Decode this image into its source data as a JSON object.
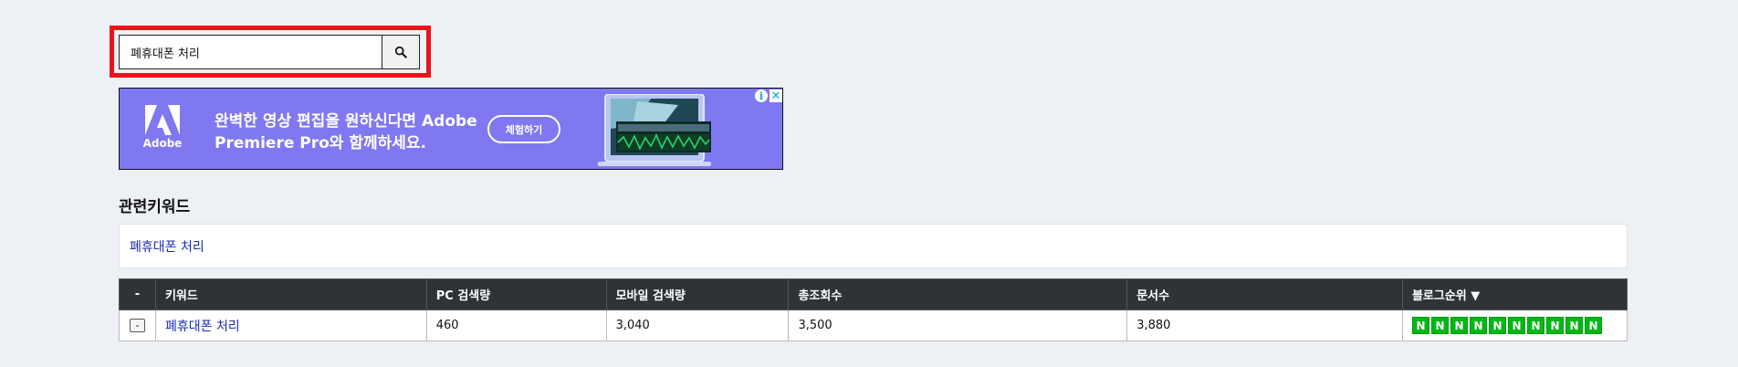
{
  "search": {
    "query": "폐휴대폰 처리",
    "button_icon": "search-icon"
  },
  "ad": {
    "logo_text": "Adobe",
    "headline_line1": "완벽한 영상 편집을 원하신다면 Adobe",
    "headline_line2": "Premiere Pro와 함께하세요.",
    "cta_label": "체험하기",
    "info_icon": "info-icon",
    "close_icon": "close-icon",
    "brand_color": "#7f78f1"
  },
  "related": {
    "title": "관련키워드",
    "keywords": [
      "폐휴대폰 처리"
    ]
  },
  "table": {
    "headers": {
      "toggle": "-",
      "keyword": "키워드",
      "pc": "PC 검색량",
      "mobile": "모바일 검색량",
      "total": "총조회수",
      "docs": "문서수",
      "blog_rank": "블로그순위 ▼"
    },
    "rows": [
      {
        "toggle": "-",
        "keyword": "폐휴대폰 처리",
        "pc": "460",
        "mobile": "3,040",
        "total": "3,500",
        "docs": "3,880",
        "blog_rank": [
          "N",
          "N",
          "N",
          "N",
          "N",
          "N",
          "N",
          "N",
          "N",
          "N"
        ]
      }
    ],
    "header_color": "#2e3436",
    "badge_color": "#03b714"
  }
}
